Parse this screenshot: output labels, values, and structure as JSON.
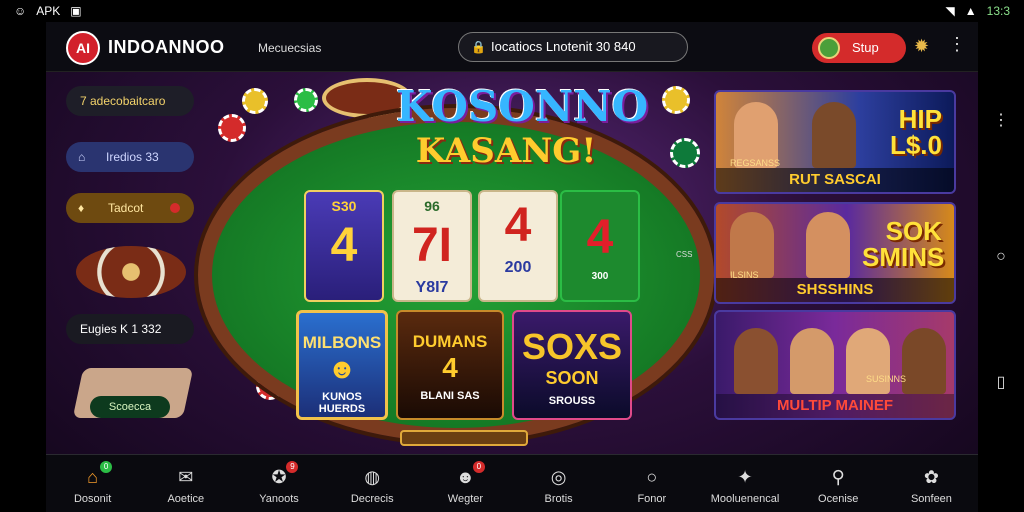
{
  "status_bar": {
    "left_app": "APK",
    "right_time": "13:3"
  },
  "header": {
    "logo_text": "AI",
    "brand": "INDOANNOO",
    "tagline": "Mecuecsias",
    "search_value": "Iocatiocs  Lnotenit  30  840",
    "signup_label": "Stup"
  },
  "sidebar": {
    "promo1": "7 adecobaitcaro",
    "promo2": "Iredios 33",
    "promo3": "Tadcot",
    "promo4": "Eugies  K 1 332",
    "deposit_chip": "Scoecca"
  },
  "center": {
    "title_top": "KOSONNO",
    "title_bottom": "KASANG!",
    "slots": [
      {
        "top": "S30",
        "num": "4",
        "bottom": ""
      },
      {
        "top": "96",
        "num": "7I",
        "bottom": "Y8I7"
      },
      {
        "top": "",
        "num": "4",
        "bottom": "200"
      },
      {
        "top": "",
        "num": "4",
        "bottom": "300"
      }
    ],
    "side_label": "CSS",
    "tiles": [
      {
        "head": "MILBONS",
        "mid": "",
        "foot": "KUNOS HUERDS"
      },
      {
        "head": "DUMANS",
        "mid": "4",
        "foot": "BLANI SAS"
      },
      {
        "head": "SOXS",
        "mid": "SOON",
        "foot": "SROUSS"
      }
    ]
  },
  "banners": [
    {
      "big": "HIP L$.0",
      "small": "REGSANSS",
      "strip": "RUT SASCAI"
    },
    {
      "big": "SOK SMINS",
      "small": "ILSINS",
      "strip": "SHSSHINS"
    },
    {
      "big": "",
      "small": "SUSINNS",
      "strip": "MULTIP MAINEF"
    }
  ],
  "bottom_nav": [
    {
      "label": "Dosonit",
      "icon": "home-icon",
      "badge": "0",
      "badge_color": "#2bbd45"
    },
    {
      "label": "Aoetice",
      "icon": "chat-icon",
      "badge": "",
      "badge_color": ""
    },
    {
      "label": "Yanoots",
      "icon": "chip-icon",
      "badge": "9",
      "badge_color": "#d42b2b"
    },
    {
      "label": "Decrecis",
      "icon": "globe-icon",
      "badge": "",
      "badge_color": ""
    },
    {
      "label": "Wegter",
      "icon": "avatar-icon",
      "badge": "0",
      "badge_color": "#d42b2b"
    },
    {
      "label": "Brotis",
      "icon": "target-icon",
      "badge": "",
      "badge_color": ""
    },
    {
      "label": "Fonor",
      "icon": "search-icon",
      "badge": "",
      "badge_color": ""
    },
    {
      "label": "Mooluenencal",
      "icon": "joystick-icon",
      "badge": "",
      "badge_color": ""
    },
    {
      "label": "Ocenise",
      "icon": "magnifier-icon",
      "badge": "",
      "badge_color": ""
    },
    {
      "label": "Sonfeen",
      "icon": "gear-icon",
      "badge": "",
      "badge_color": ""
    }
  ]
}
